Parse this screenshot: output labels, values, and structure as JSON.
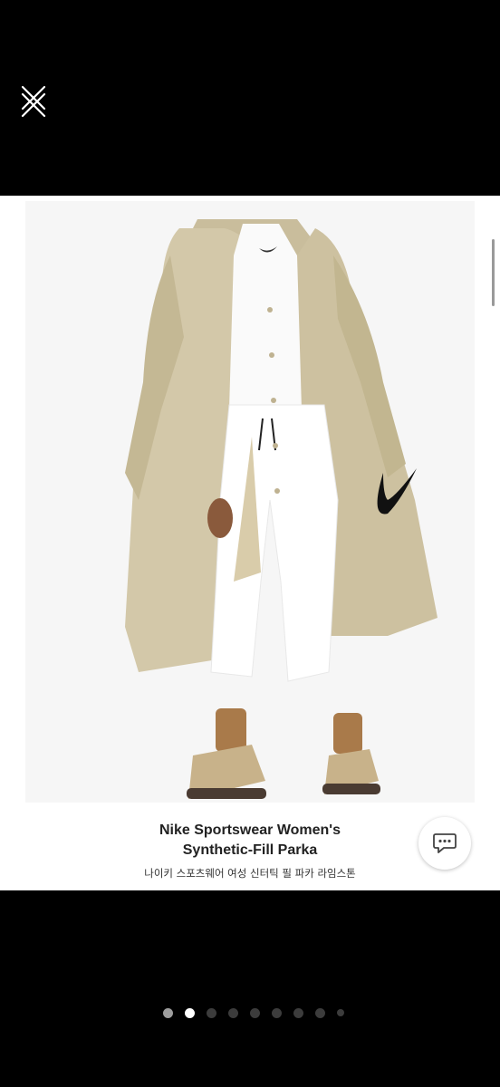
{
  "viewer": {
    "close_icon": "close-x-icon",
    "current_index": 2,
    "total_images": 9
  },
  "product": {
    "title": "Nike Sportswear Women's Synthetic-Fill Parka",
    "subtitle_ko": "나이키 스포츠웨어 여성 신터틱 필 파카 라임스톤"
  },
  "chat": {
    "icon": "chat-bubble-icon"
  },
  "colors": {
    "background": "#000000",
    "photo_bg": "#ffffff",
    "coat": "#cfc3a3",
    "dot_active": "#ffffff",
    "dot_inactive": "#3c3c3c"
  }
}
